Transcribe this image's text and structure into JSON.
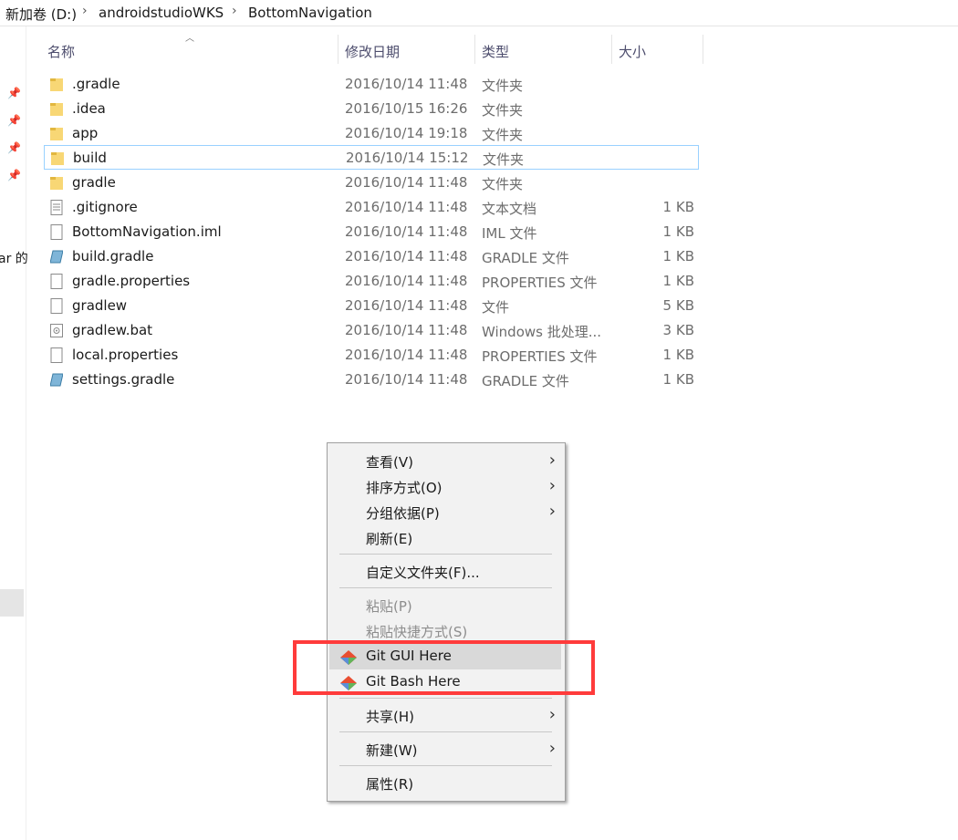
{
  "breadcrumb": {
    "items": [
      "新加卷 (D:)",
      "androidstudioWKS",
      "BottomNavigation"
    ]
  },
  "nav": {
    "partial_text": "ar 的"
  },
  "columns": {
    "name": "名称",
    "date": "修改日期",
    "type": "类型",
    "size": "大小"
  },
  "files": [
    {
      "name": ".gradle",
      "date": "2016/10/14 11:48",
      "type": "文件夹",
      "size": "",
      "icon": "folder-icon"
    },
    {
      "name": ".idea",
      "date": "2016/10/15 16:26",
      "type": "文件夹",
      "size": "",
      "icon": "folder-icon"
    },
    {
      "name": "app",
      "date": "2016/10/14 19:18",
      "type": "文件夹",
      "size": "",
      "icon": "folder-icon"
    },
    {
      "name": "build",
      "date": "2016/10/14 15:12",
      "type": "文件夹",
      "size": "",
      "icon": "folder-icon",
      "selected": true
    },
    {
      "name": "gradle",
      "date": "2016/10/14 11:48",
      "type": "文件夹",
      "size": "",
      "icon": "folder-icon"
    },
    {
      "name": ".gitignore",
      "date": "2016/10/14 11:48",
      "type": "文本文档",
      "size": "1 KB",
      "icon": "text-file-icon"
    },
    {
      "name": "BottomNavigation.iml",
      "date": "2016/10/14 11:48",
      "type": "IML 文件",
      "size": "1 KB",
      "icon": "file-icon"
    },
    {
      "name": "build.gradle",
      "date": "2016/10/14 11:48",
      "type": "GRADLE 文件",
      "size": "1 KB",
      "icon": "gradle-file-icon"
    },
    {
      "name": "gradle.properties",
      "date": "2016/10/14 11:48",
      "type": "PROPERTIES 文件",
      "size": "1 KB",
      "icon": "file-icon"
    },
    {
      "name": "gradlew",
      "date": "2016/10/14 11:48",
      "type": "文件",
      "size": "5 KB",
      "icon": "file-icon"
    },
    {
      "name": "gradlew.bat",
      "date": "2016/10/14 11:48",
      "type": "Windows 批处理...",
      "size": "3 KB",
      "icon": "batch-file-icon"
    },
    {
      "name": "local.properties",
      "date": "2016/10/14 11:48",
      "type": "PROPERTIES 文件",
      "size": "1 KB",
      "icon": "file-icon"
    },
    {
      "name": "settings.gradle",
      "date": "2016/10/14 11:48",
      "type": "GRADLE 文件",
      "size": "1 KB",
      "icon": "gradle-file-icon"
    }
  ],
  "context_menu": {
    "view": "查看(V)",
    "sort_by": "排序方式(O)",
    "group_by": "分组依据(P)",
    "refresh": "刷新(E)",
    "customize_folder": "自定义文件夹(F)...",
    "paste": "粘贴(P)",
    "paste_shortcut": "粘贴快捷方式(S)",
    "git_gui": "Git GUI Here",
    "git_bash": "Git Bash Here",
    "share": "共享(H)",
    "new": "新建(W)",
    "properties": "属性(R)"
  },
  "colors": {
    "highlight_box": "#ff3b3b",
    "selection_border": "#99d1ff",
    "folder_yellow": "#f8d775"
  }
}
